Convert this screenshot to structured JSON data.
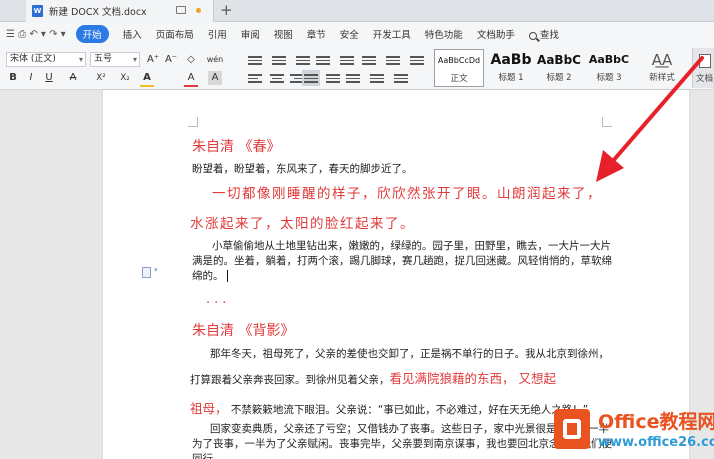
{
  "tabbar": {
    "doc_title": "新建 DOCX 文档.docx",
    "doc_icon_letter": "W",
    "new_tab": "+"
  },
  "menubar": {
    "quick_access": "☰  ⎙  ↶ ▾  ↷  ▾",
    "items": [
      "开始",
      "插入",
      "页面布局",
      "引用",
      "审阅",
      "视图",
      "章节",
      "安全",
      "开发工具",
      "特色功能",
      "文档助手"
    ],
    "search_label": "查找"
  },
  "ribbon": {
    "font_name": "宋体 (正文)",
    "font_size": "五号",
    "size_up": "A⁺",
    "size_down": "A⁻",
    "clear": "◇",
    "pinyin": "wén",
    "bold": "B",
    "italic": "I",
    "underline": "U",
    "strike": "A",
    "superscript": "X²",
    "subscript": "X₂",
    "font_color": "A",
    "highlight": "A",
    "char_shade": "A",
    "styles": [
      {
        "sample": "AaBbCcDd",
        "name": "正文"
      },
      {
        "sample": "AaBb",
        "name": "标题 1"
      },
      {
        "sample": "AaBbC",
        "name": "标题 2"
      },
      {
        "sample": "AaBbC",
        "name": "标题 3"
      }
    ],
    "new_style": "新样式",
    "side_label": "文档"
  },
  "document": {
    "title1": "朱自清 《春》",
    "line1": "盼望着，盼望着，东风来了，春天的脚步近了。",
    "red1": "一切都像刚睡醒的样子，欣欣然张开了眼。山朗润起来了，",
    "red2": "水涨起来了，太阳的脸红起来了。",
    "para2_l1": "小草偷偷地从土地里钻出来，嫩嫩的，绿绿的。园子里，田野里，瞧去，一大片一大片",
    "para2_l2": "满是的。坐着，躺着，打两个滚，踢几脚球，赛几趟跑，捉几回迷藏。风轻悄悄的，草软绵",
    "para2_l3": "绵的。",
    "ellipsis": "...",
    "title2": "朱自清 《背影》",
    "p3_l1": "那年冬天，祖母死了，父亲的差使也交卸了，正是祸不单行的日子。我从北京到徐州，",
    "p3_l2_black": "打算跟着父亲奔丧回家。到徐州见着父亲，",
    "p3_l2_red": "看见满院狼藉的东西， 又想起",
    "p3_l3_red": "祖母，",
    "p3_l3_black": " 不禁簌簌地流下眼泪。父亲说：“事已如此，不必难过，好在天无绝人之路！”",
    "p4_l1": "回家变卖典质，父亲还了亏空；又借钱办了丧事。这些日子，家中光景很是惨淡，一半",
    "p4_l2": "为了丧事，一半为了父亲赋闲。丧事完毕，父亲要到南京谋事，我也要回北京念书，我们便",
    "p4_l3": "同行。"
  },
  "watermark": {
    "brand": "Office教程网",
    "url": "www.office26.com"
  },
  "colors": {
    "accent": "#2c7be5",
    "title_red": "#e03a3a",
    "arrow_red": "#e8202a",
    "brand_orange": "#e8531f"
  }
}
